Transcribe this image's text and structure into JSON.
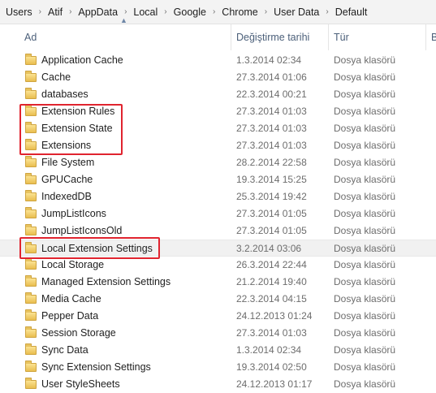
{
  "breadcrumb": [
    "Users",
    "Atif",
    "AppData",
    "Local",
    "Google",
    "Chrome",
    "User Data",
    "Default"
  ],
  "columns": {
    "name": "Ad",
    "date": "Değiştirme tarihi",
    "type": "Tür",
    "size": "B"
  },
  "rows": [
    {
      "name": "Application Cache",
      "date": "1.3.2014 02:34",
      "type": "Dosya klasörü"
    },
    {
      "name": "Cache",
      "date": "27.3.2014 01:06",
      "type": "Dosya klasörü"
    },
    {
      "name": "databases",
      "date": "22.3.2014 00:21",
      "type": "Dosya klasörü"
    },
    {
      "name": "Extension Rules",
      "date": "27.3.2014 01:03",
      "type": "Dosya klasörü"
    },
    {
      "name": "Extension State",
      "date": "27.3.2014 01:03",
      "type": "Dosya klasörü"
    },
    {
      "name": "Extensions",
      "date": "27.3.2014 01:03",
      "type": "Dosya klasörü"
    },
    {
      "name": "File System",
      "date": "28.2.2014 22:58",
      "type": "Dosya klasörü"
    },
    {
      "name": "GPUCache",
      "date": "19.3.2014 15:25",
      "type": "Dosya klasörü"
    },
    {
      "name": "IndexedDB",
      "date": "25.3.2014 19:42",
      "type": "Dosya klasörü"
    },
    {
      "name": "JumpListIcons",
      "date": "27.3.2014 01:05",
      "type": "Dosya klasörü"
    },
    {
      "name": "JumpListIconsOld",
      "date": "27.3.2014 01:05",
      "type": "Dosya klasörü"
    },
    {
      "name": "Local Extension Settings",
      "date": "3.2.2014 03:06",
      "type": "Dosya klasörü",
      "selected": true
    },
    {
      "name": "Local Storage",
      "date": "26.3.2014 22:44",
      "type": "Dosya klasörü"
    },
    {
      "name": "Managed Extension Settings",
      "date": "21.2.2014 19:40",
      "type": "Dosya klasörü"
    },
    {
      "name": "Media Cache",
      "date": "22.3.2014 04:15",
      "type": "Dosya klasörü"
    },
    {
      "name": "Pepper Data",
      "date": "24.12.2013 01:24",
      "type": "Dosya klasörü"
    },
    {
      "name": "Session Storage",
      "date": "27.3.2014 01:03",
      "type": "Dosya klasörü"
    },
    {
      "name": "Sync Data",
      "date": "1.3.2014 02:34",
      "type": "Dosya klasörü"
    },
    {
      "name": "Sync Extension Settings",
      "date": "19.3.2014 02:50",
      "type": "Dosya klasörü"
    },
    {
      "name": "User StyleSheets",
      "date": "24.12.2013 01:17",
      "type": "Dosya klasörü"
    }
  ],
  "colors": {
    "annotation": "#e0242f",
    "header_text": "#4c607a",
    "folder": "#f0cc61"
  }
}
